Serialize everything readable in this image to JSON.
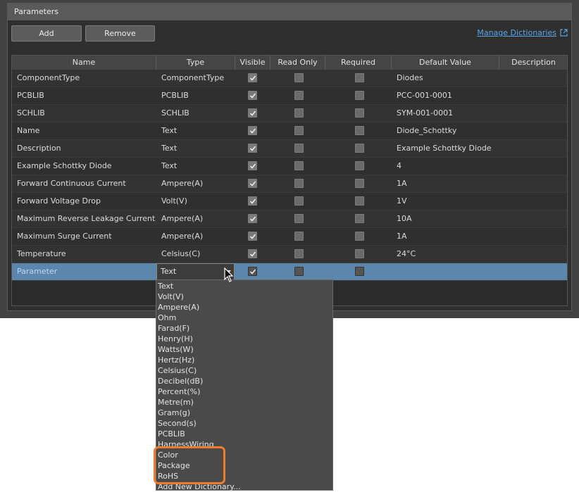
{
  "panel": {
    "title": "Parameters"
  },
  "toolbar": {
    "add_label": "Add",
    "remove_label": "Remove",
    "manage_label": "Manage Dictionaries"
  },
  "table": {
    "columns": [
      "Name",
      "Type",
      "Visible",
      "Read Only",
      "Required",
      "Default Value",
      "Description"
    ],
    "rows": [
      {
        "name": "ComponentType",
        "type": "ComponentType",
        "visible": true,
        "read_only": false,
        "required": false,
        "default": "Diodes",
        "description": ""
      },
      {
        "name": "PCBLIB",
        "type": "PCBLIB",
        "visible": true,
        "read_only": false,
        "required": false,
        "default": "PCC-001-0001",
        "description": ""
      },
      {
        "name": "SCHLIB",
        "type": "SCHLIB",
        "visible": true,
        "read_only": false,
        "required": false,
        "default": "SYM-001-0001",
        "description": ""
      },
      {
        "name": "Name",
        "type": "Text",
        "visible": true,
        "read_only": false,
        "required": false,
        "default": "Diode_Schottky",
        "description": ""
      },
      {
        "name": "Description",
        "type": "Text",
        "visible": true,
        "read_only": false,
        "required": false,
        "default": "Example Schottky Diode",
        "description": ""
      },
      {
        "name": "Example Schottky Diode",
        "type": "Text",
        "visible": true,
        "read_only": false,
        "required": false,
        "default": "4",
        "description": ""
      },
      {
        "name": "Forward Continuous Current",
        "type": "Ampere(A)",
        "visible": true,
        "read_only": false,
        "required": false,
        "default": "1A",
        "description": ""
      },
      {
        "name": "Forward Voltage Drop",
        "type": "Volt(V)",
        "visible": true,
        "read_only": false,
        "required": false,
        "default": "1V",
        "description": ""
      },
      {
        "name": "Maximum Reverse Leakage Current",
        "type": "Ampere(A)",
        "visible": true,
        "read_only": false,
        "required": false,
        "default": "10A",
        "description": ""
      },
      {
        "name": "Maximum Surge Current",
        "type": "Ampere(A)",
        "visible": true,
        "read_only": false,
        "required": false,
        "default": "1A",
        "description": ""
      },
      {
        "name": "Temperature",
        "type": "Celsius(C)",
        "visible": true,
        "read_only": false,
        "required": false,
        "default": "24°C",
        "description": ""
      },
      {
        "name": "Parameter",
        "type": "Text",
        "visible": true,
        "read_only": false,
        "required": false,
        "default": "",
        "description": "",
        "selected": true
      }
    ]
  },
  "type_dropdown": {
    "options": [
      "Text",
      "Volt(V)",
      "Ampere(A)",
      "Ohm",
      "Farad(F)",
      "Henry(H)",
      "Watts(W)",
      "Hertz(Hz)",
      "Celsius(C)",
      "Decibel(dB)",
      "Percent(%)",
      "Metre(m)",
      "Gram(g)",
      "Second(s)",
      "PCBLIB",
      "HarnessWiring",
      "Color",
      "Package",
      "RoHS",
      "Add New Dictionary..."
    ],
    "highlighted": [
      "Color",
      "Package",
      "RoHS"
    ]
  },
  "colors": {
    "accent_highlight": "#f07d2a",
    "selection": "#5d86ad",
    "link": "#5aa6e8"
  }
}
